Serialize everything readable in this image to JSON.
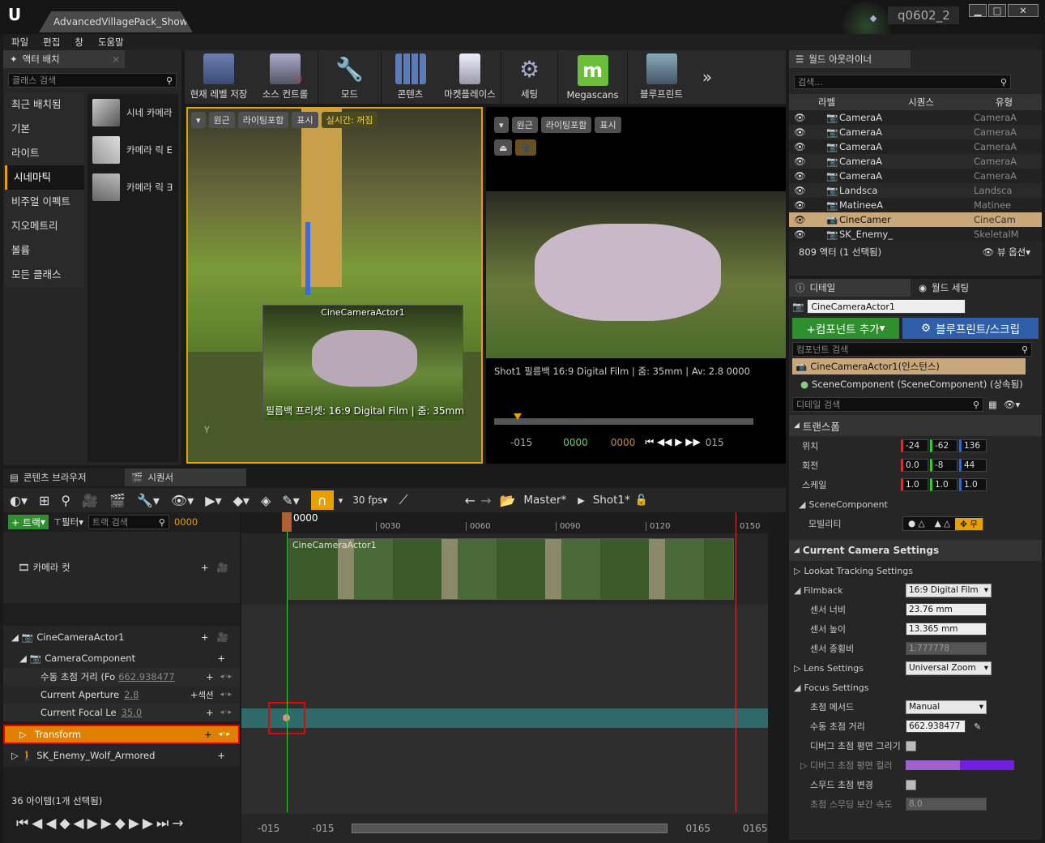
{
  "window": {
    "tab_title": "AdvancedVillagePack_Show*",
    "project": "q0602_2"
  },
  "menu": [
    "파일",
    "편집",
    "창",
    "도움말"
  ],
  "place": {
    "tab": "액터 배치",
    "search": "클래스 검색",
    "categories": [
      "최근 배치됨",
      "기본",
      "라이트",
      "시네마틱",
      "비주얼 이펙트",
      "지오메트리",
      "볼륨",
      "모든 클래스"
    ],
    "items": [
      "시네 카메라",
      "카메라 릭 E",
      "카메라 릭 ∃"
    ]
  },
  "toolbar": [
    {
      "label": "현재 레벨 저장",
      "icon": "save-icon"
    },
    {
      "label": "소스 컨트롤",
      "icon": "source-control-icon"
    },
    {
      "label": "모드",
      "icon": "modes-icon"
    },
    {
      "label": "콘텐츠",
      "icon": "content-icon"
    },
    {
      "label": "마켓플레이스",
      "icon": "marketplace-icon"
    },
    {
      "label": "세팅",
      "icon": "settings-icon"
    },
    {
      "label": "Megascans",
      "icon": "megascans-icon"
    },
    {
      "label": "블루프린트",
      "icon": "blueprint-icon"
    }
  ],
  "viewport_left": {
    "pills": [
      "원근",
      "라이팅포함",
      "표시",
      "실시간: 꺼짐"
    ],
    "pip_title": "CineCameraActor1",
    "pip_caption": "필름백 프리셋: 16:9 Digital Film | 줌: 35mm"
  },
  "viewport_right": {
    "pills": [
      "원근",
      "라이팅포함",
      "표시"
    ],
    "info": "Shot1  필름백 16:9 Digital Film | 줌: 35mm | Av: 2.8   0000",
    "t1": "-015",
    "t2": "0000",
    "t3": "0000",
    "t4": "015"
  },
  "outliner": {
    "tab": "월드 아웃라이너",
    "search": "검색...",
    "cols": [
      "라벨",
      "시퀀스",
      "유형"
    ],
    "rows": [
      [
        "CameraA",
        "CameraA"
      ],
      [
        "CameraA",
        "CameraA"
      ],
      [
        "CameraA",
        "CameraA"
      ],
      [
        "CameraA",
        "CameraA"
      ],
      [
        "CameraA",
        "CameraA"
      ],
      [
        "Landsca",
        "Landsca"
      ],
      [
        "MatineeA",
        "Matinee"
      ],
      [
        "CineCamer",
        "CineCam"
      ],
      [
        "SK_Enemy_",
        "SkeletalM"
      ]
    ],
    "status": "809 액터 (1 선택됨)",
    "view_options": "뷰 옵션"
  },
  "details": {
    "tab": "디테일",
    "tab2": "월드 세팅",
    "actor_name": "CineCameraActor1",
    "add_component": "+컴포넌트 추가",
    "blueprint_btn": "블루프린트/스크립",
    "comp_search": "컴포넌트 검색",
    "comp_root": "CineCameraActor1(인스턴스)",
    "comp_child": "SceneComponent (SceneComponent) (상속됨)",
    "detail_search": "디테일 검색",
    "transform": "트랜스폼",
    "location": {
      "label": "위치",
      "v": [
        "-24",
        "-62",
        "136"
      ]
    },
    "rotation": {
      "label": "회전",
      "v": [
        "0.0",
        "-8",
        "44"
      ]
    },
    "scale": {
      "label": "스케일",
      "v": [
        "1.0",
        "1.0",
        "1.0"
      ]
    },
    "scene_comp": "SceneComponent",
    "mobility": "모빌리티",
    "mobility_val": "무",
    "camera_settings": "Current Camera Settings",
    "lookat": "Lookat Tracking Settings",
    "filmback": "Filmback",
    "filmback_val": "16:9 Digital Film",
    "sensor_w": "센서 너비",
    "sensor_w_val": "23.76 mm",
    "sensor_h": "센서 높이",
    "sensor_h_val": "13.365 mm",
    "sensor_ar": "센서 종횡비",
    "sensor_ar_val": "1.777778",
    "lens": "Lens Settings",
    "lens_val": "Universal Zoom",
    "focus": "Focus Settings",
    "focus_method": "초점 메서드",
    "focus_method_val": "Manual",
    "manual_focus": "수동 초점 거리",
    "manual_focus_val": "662.938477",
    "debug_plane": "디버그 초점 평면 그리기",
    "debug_color": "디버그 초점 평면 컬러",
    "smooth": "스무드 초점 변경",
    "smooth_speed": "초점 스무딩 보간 속도",
    "smooth_speed_val": "8.0"
  },
  "bottom_tabs": [
    "콘텐츠 브라우저",
    "시퀀서"
  ],
  "sequencer": {
    "fps": "30 fps",
    "master": "Master*",
    "shot": "Shot1*",
    "track_btn": "+ 트랙",
    "filter": "필터",
    "track_search": "트랙 검색",
    "time": "0000",
    "tracks": {
      "cam_cuts": "카메라 컷",
      "actor": "CineCameraActor1",
      "component": "CameraComponent",
      "focus": "수동 초점 거리 (Fo",
      "focus_val": "662.938477",
      "aperture": "Current Aperture",
      "aperture_val": "2.8",
      "section": "섹션",
      "focal": "Current Focal Le",
      "focal_val": "35.0",
      "transform": "Transform",
      "wolf": "SK_Enemy_Wolf_Armored"
    },
    "status": "36 아이템(1개 선택됨)",
    "ticks": [
      "0000",
      "0030",
      "0060",
      "0090",
      "0120",
      "0150"
    ],
    "bottom_nums": [
      "-015",
      "-015",
      "0165",
      "0165"
    ],
    "clip_label": "CineCameraActor1"
  }
}
